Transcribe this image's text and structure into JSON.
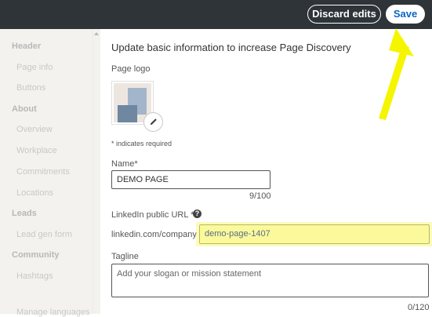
{
  "topbar": {
    "discard_label": "Discard edits",
    "save_label": "Save"
  },
  "sidebar": {
    "items": [
      {
        "label": "Header",
        "kind": "group"
      },
      {
        "label": "Page info",
        "kind": "sub"
      },
      {
        "label": "Buttons",
        "kind": "sub"
      },
      {
        "label": "About",
        "kind": "group"
      },
      {
        "label": "Overview",
        "kind": "sub"
      },
      {
        "label": "Workplace",
        "kind": "sub"
      },
      {
        "label": "Commitments",
        "kind": "sub"
      },
      {
        "label": "Locations",
        "kind": "sub"
      },
      {
        "label": "Leads",
        "kind": "group"
      },
      {
        "label": "Lead gen form",
        "kind": "sub"
      },
      {
        "label": "Community",
        "kind": "group"
      },
      {
        "label": "Hashtags",
        "kind": "sub"
      },
      {
        "label": "Manage languages",
        "kind": "sub"
      }
    ]
  },
  "main": {
    "title": "Update basic information to increase Page Discovery",
    "logo_label": "Page logo",
    "required_note": "* indicates required",
    "name_label": "Name*",
    "name_value": "DEMO PAGE",
    "name_counter": "9/100",
    "url_label": "LinkedIn public URL *",
    "url_prefix": "linkedin.com/company",
    "url_value": "demo-page-1407",
    "tagline_label": "Tagline",
    "tagline_placeholder": "Add your slogan or mission statement",
    "tagline_counter": "0/120"
  },
  "colors": {
    "topbar_bg": "#2e3438",
    "accent": "#0a66c2",
    "highlight": "#f7f76a",
    "arrow": "#f5f500"
  },
  "icons": {
    "edit": "pencil-icon",
    "info": "info-icon",
    "annotation": "arrow-icon"
  }
}
